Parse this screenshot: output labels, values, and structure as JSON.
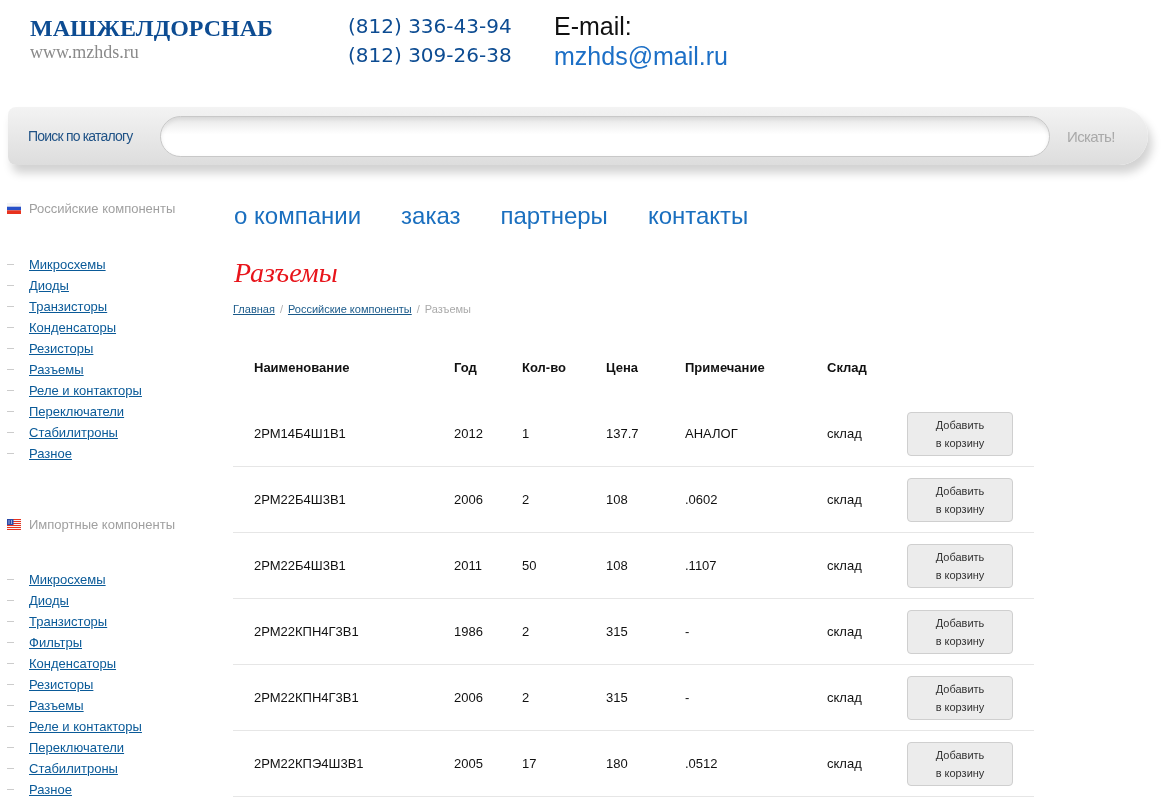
{
  "header": {
    "logo": "МАШЖЕЛДОРСНАБ",
    "site": "www.mzhds.ru",
    "phones": [
      "(812) 336-43-94",
      "(812) 309-26-38"
    ],
    "email_label": "E-mail:",
    "email": "mzhds@mail.ru"
  },
  "search": {
    "label": "Поиск по каталогу",
    "button": "Искать!"
  },
  "sidebar": {
    "groups": [
      {
        "title": "Российские компоненты",
        "kind": "tricolor",
        "items": [
          "Микросхемы",
          "Диоды",
          "Транзисторы",
          "Конденсаторы",
          "Резисторы",
          "Разъемы",
          "Реле и контакторы",
          "Переключатели",
          "Стабилитроны",
          "Разное"
        ]
      },
      {
        "title": "Импортные компоненты",
        "kind": "stripes",
        "items": [
          "Микросхемы",
          "Диоды",
          "Транзисторы",
          "Фильтры",
          "Конденсаторы",
          "Резисторы",
          "Разъемы",
          "Реле и контакторы",
          "Переключатели",
          "Стабилитроны",
          "Разное"
        ]
      }
    ]
  },
  "nav": [
    "о компании",
    "заказ",
    "партнеры",
    "контакты"
  ],
  "page_title": "Разъемы",
  "breadcrumb": {
    "separator": "/",
    "items": [
      {
        "label": "Главная",
        "kind": "link"
      },
      {
        "label": "Российские компоненты",
        "kind": "link"
      },
      {
        "label": "Разъемы",
        "kind": "current"
      }
    ]
  },
  "table": {
    "columns": [
      "Наименование",
      "Год",
      "Кол-во",
      "Цена",
      "Примечание",
      "Склад"
    ],
    "rows": [
      {
        "cells": [
          "2РМ14Б4Ш1В1",
          "2012",
          "1",
          "137.7",
          "АНАЛОГ",
          "склад"
        ],
        "button": "Добавить в корзину"
      },
      {
        "cells": [
          "2РМ22Б4Ш3В1",
          "2006",
          "2",
          "108",
          ".0602",
          "склад"
        ],
        "button": "Добавить в корзину"
      },
      {
        "cells": [
          "2РМ22Б4Ш3В1",
          "2011",
          "50",
          "108",
          ".1107",
          "склад"
        ],
        "button": "Добавить в корзину"
      },
      {
        "cells": [
          "2РМ22КПН4Г3В1",
          "1986",
          "2",
          "315",
          "-",
          "склад"
        ],
        "button": "Добавить в корзину"
      },
      {
        "cells": [
          "2РМ22КПН4Г3В1",
          "2006",
          "2",
          "315",
          "-",
          "склад"
        ],
        "button": "Добавить в корзину"
      },
      {
        "cells": [
          "2РМ22КПЭ4Ш3В1",
          "2005",
          "17",
          "180",
          ".0512",
          "склад"
        ],
        "button": "Добавить в корзину"
      }
    ]
  }
}
